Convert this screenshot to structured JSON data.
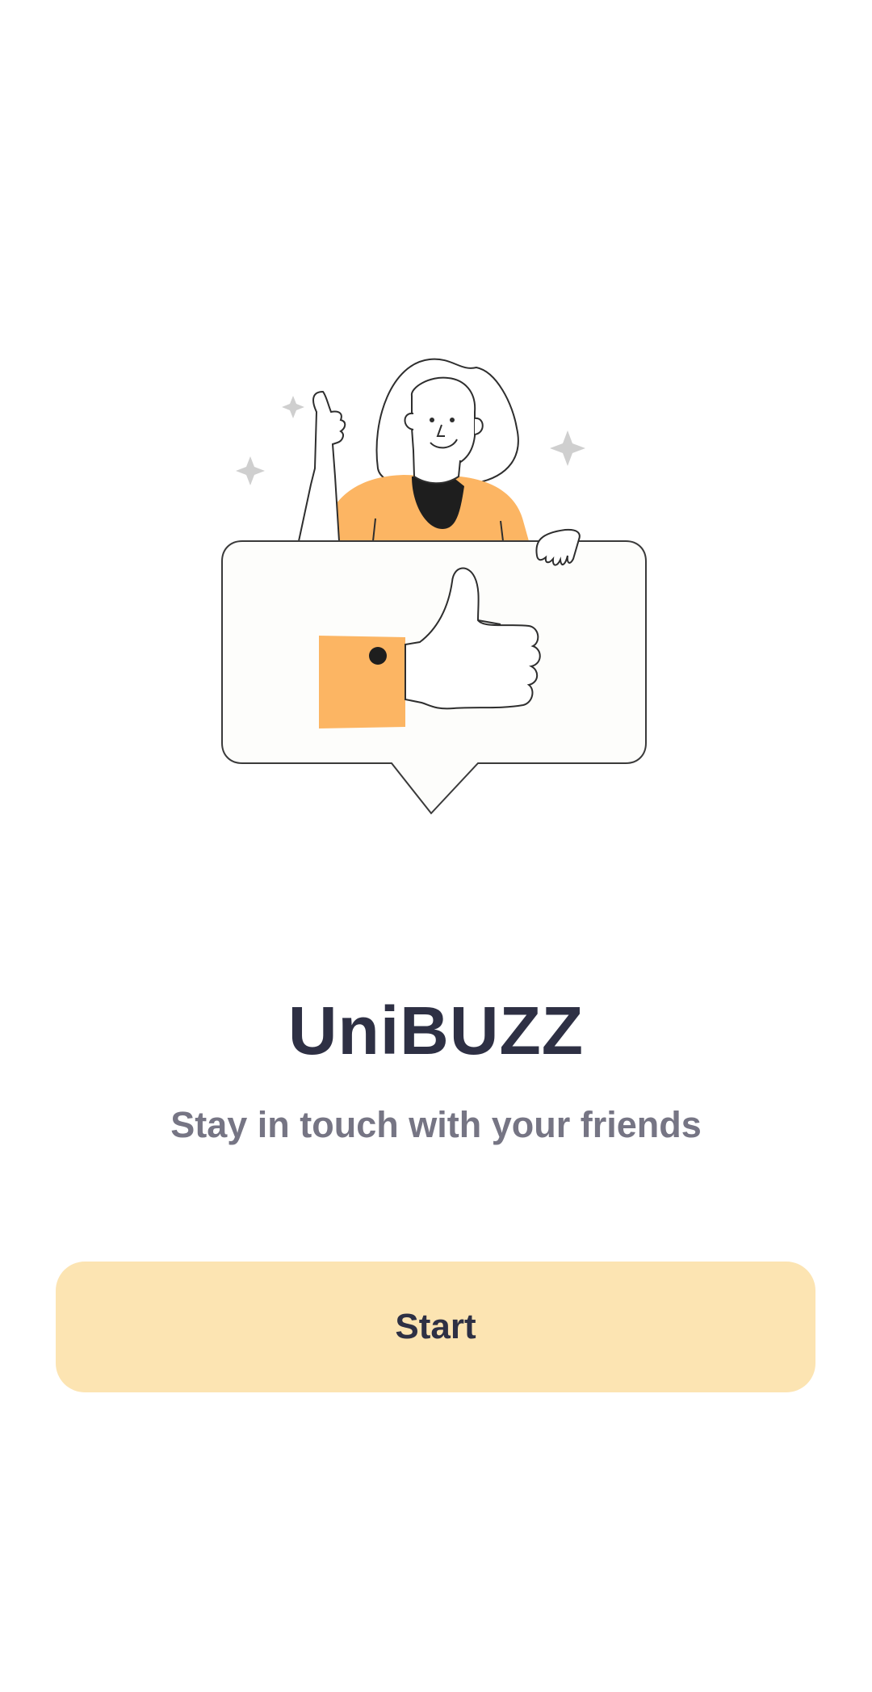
{
  "app": {
    "title": "UniBUZZ",
    "tagline": "Stay in touch with your friends"
  },
  "actions": {
    "start_label": "Start"
  },
  "illustration": {
    "icon": "thumbs-up-person-illustration"
  },
  "colors": {
    "background": "#ffffff",
    "title": "#2e3044",
    "tagline": "#767584",
    "button_bg": "#fce4b2",
    "button_text": "#2e3044",
    "accent_orange": "#fcb563",
    "outline": "#2e2e2e",
    "sparkle": "#cfcfcf"
  }
}
